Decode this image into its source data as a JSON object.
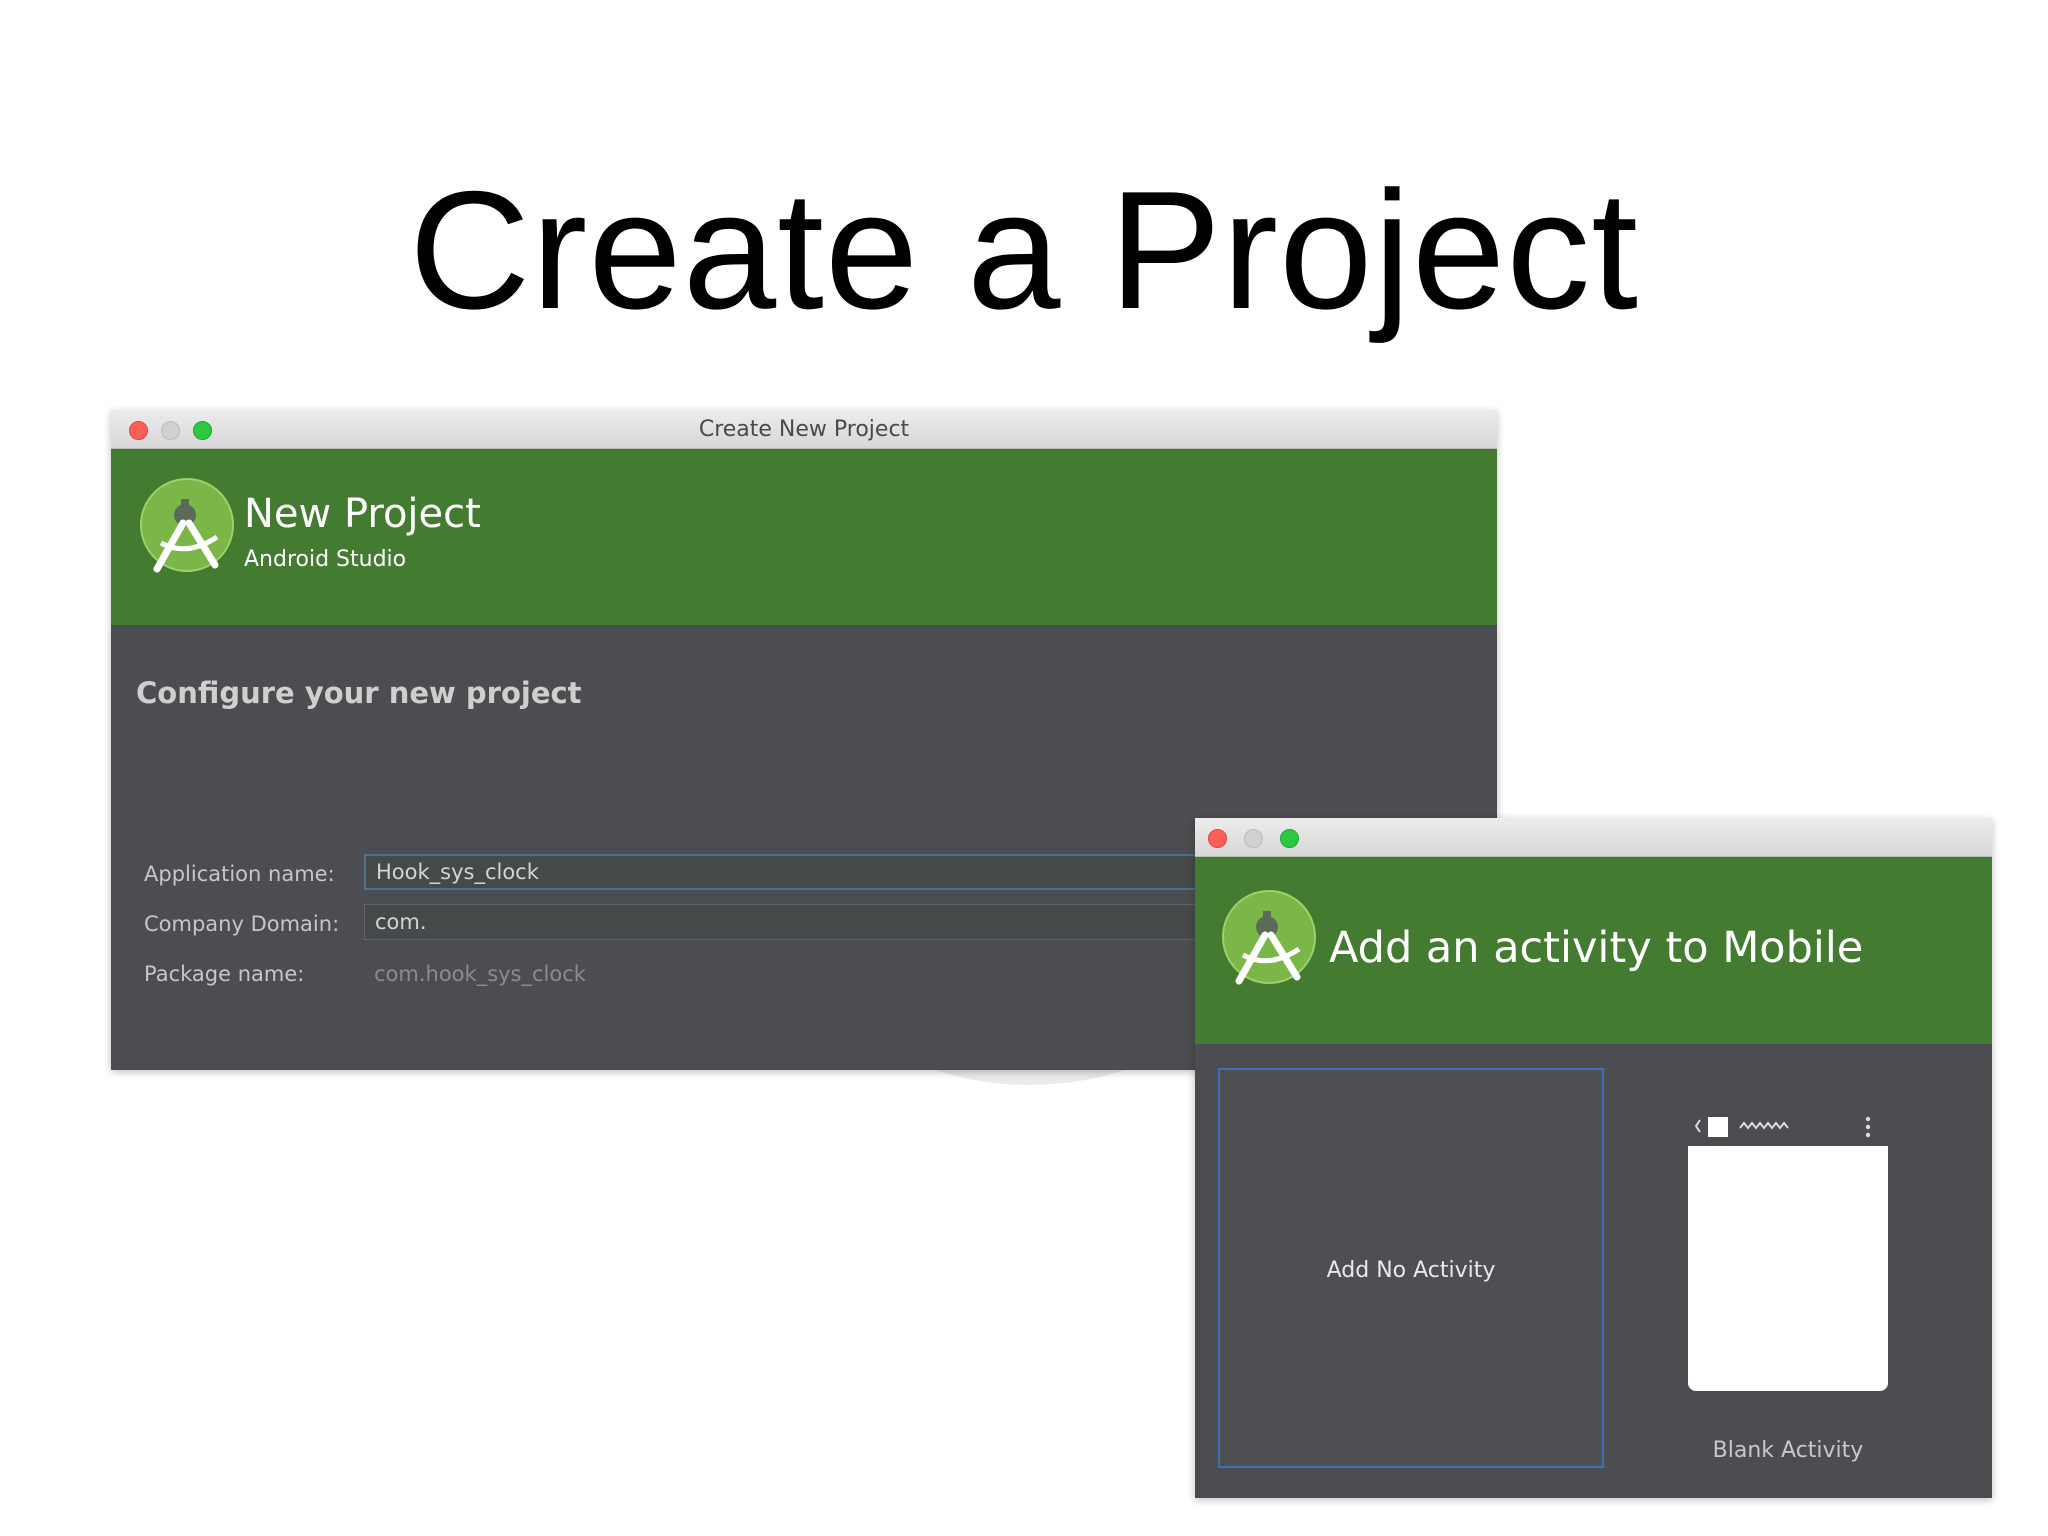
{
  "slide": {
    "title": "Create a Project"
  },
  "window_new_project": {
    "titlebar": "Create New Project",
    "header_title": "New Project",
    "header_subtitle": "Android Studio",
    "logo_icon": "android-studio-icon",
    "section_heading": "Configure your new project",
    "fields": {
      "app_name_label": "Application name:",
      "app_name_value": "Hook_sys_clock",
      "company_domain_label": "Company Domain:",
      "company_domain_value": "com.",
      "package_name_label": "Package name:",
      "package_name_value": "com.hook_sys_clock"
    }
  },
  "window_add_activity": {
    "header_title": "Add an activity to Mobile",
    "logo_icon": "android-studio-icon",
    "tiles": {
      "no_activity_label": "Add No Activity",
      "blank_activity_label": "Blank Activity"
    }
  },
  "colors": {
    "header_green": "#437c30",
    "panel_dark": "#4c4d50",
    "selection_blue": "#3c72b5"
  }
}
